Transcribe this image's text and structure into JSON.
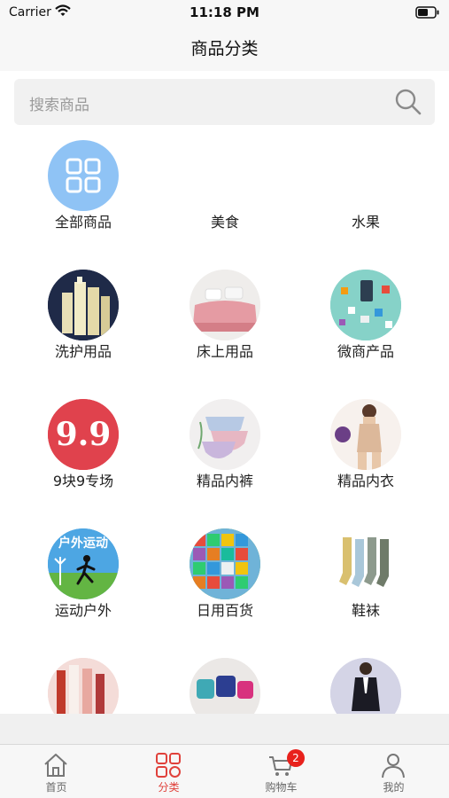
{
  "status_bar": {
    "carrier": "Carrier",
    "time": "11:18 PM"
  },
  "nav": {
    "title": "商品分类"
  },
  "search": {
    "placeholder": "搜索商品"
  },
  "categories": [
    {
      "label": "全部商品",
      "icon": "grid-icon"
    },
    {
      "label": "美食",
      "icon": ""
    },
    {
      "label": "水果",
      "icon": ""
    },
    {
      "label": "洗护用品",
      "icon": "bottles-image"
    },
    {
      "label": "床上用品",
      "icon": "bedding-image"
    },
    {
      "label": "微商产品",
      "icon": "micro-shop-image"
    },
    {
      "label": "9块9专场",
      "icon": "nine-nine-image",
      "image_text": "9.9"
    },
    {
      "label": "精品内裤",
      "icon": "underwear-image"
    },
    {
      "label": "精品内衣",
      "icon": "lingerie-image"
    },
    {
      "label": "运动户外",
      "icon": "outdoor-image",
      "image_text": "户外运动"
    },
    {
      "label": "日用百货",
      "icon": "daily-goods-image"
    },
    {
      "label": "鞋袜",
      "icon": "socks-image"
    },
    {
      "label": "",
      "icon": "cosmetics-image"
    },
    {
      "label": "",
      "icon": "luggage-image"
    },
    {
      "label": "",
      "icon": "menswear-image"
    }
  ],
  "tabs": [
    {
      "label": "首页",
      "icon": "home-icon"
    },
    {
      "label": "分类",
      "icon": "category-icon"
    },
    {
      "label": "购物车",
      "icon": "cart-icon",
      "badge": "2"
    },
    {
      "label": "我的",
      "icon": "profile-icon"
    }
  ],
  "colors": {
    "accent": "#e0413b",
    "badge": "#e8211c",
    "all_icon_bg": "#8fc3f5"
  }
}
